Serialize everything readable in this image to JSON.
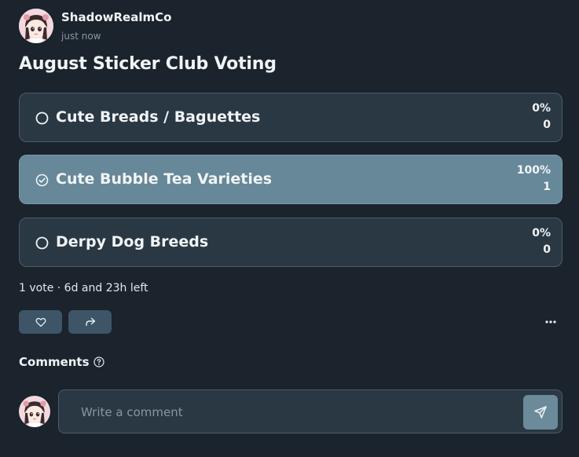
{
  "post": {
    "author": "ShadowRealmCo",
    "time": "just now",
    "title": "August Sticker Club Voting"
  },
  "poll": {
    "options": [
      {
        "label": "Cute Breads / Baguettes",
        "percent": "0%",
        "count": "0",
        "selected": false
      },
      {
        "label": "Cute Bubble Tea Varieties",
        "percent": "100%",
        "count": "1",
        "selected": true
      },
      {
        "label": "Derpy Dog Breeds",
        "percent": "0%",
        "count": "0",
        "selected": false
      }
    ],
    "summary": "1 vote · 6d and 23h left"
  },
  "actions": {
    "like_icon": "heart-icon",
    "share_icon": "share-arrow-icon",
    "more_icon": "more-dots-icon"
  },
  "comments": {
    "heading": "Comments",
    "placeholder": "Write a comment",
    "send_icon": "send-icon"
  },
  "colors": {
    "background": "#1b232c",
    "option_bg": "#2a3844",
    "option_selected_bg": "#668898",
    "button_bg": "#3d5566"
  }
}
